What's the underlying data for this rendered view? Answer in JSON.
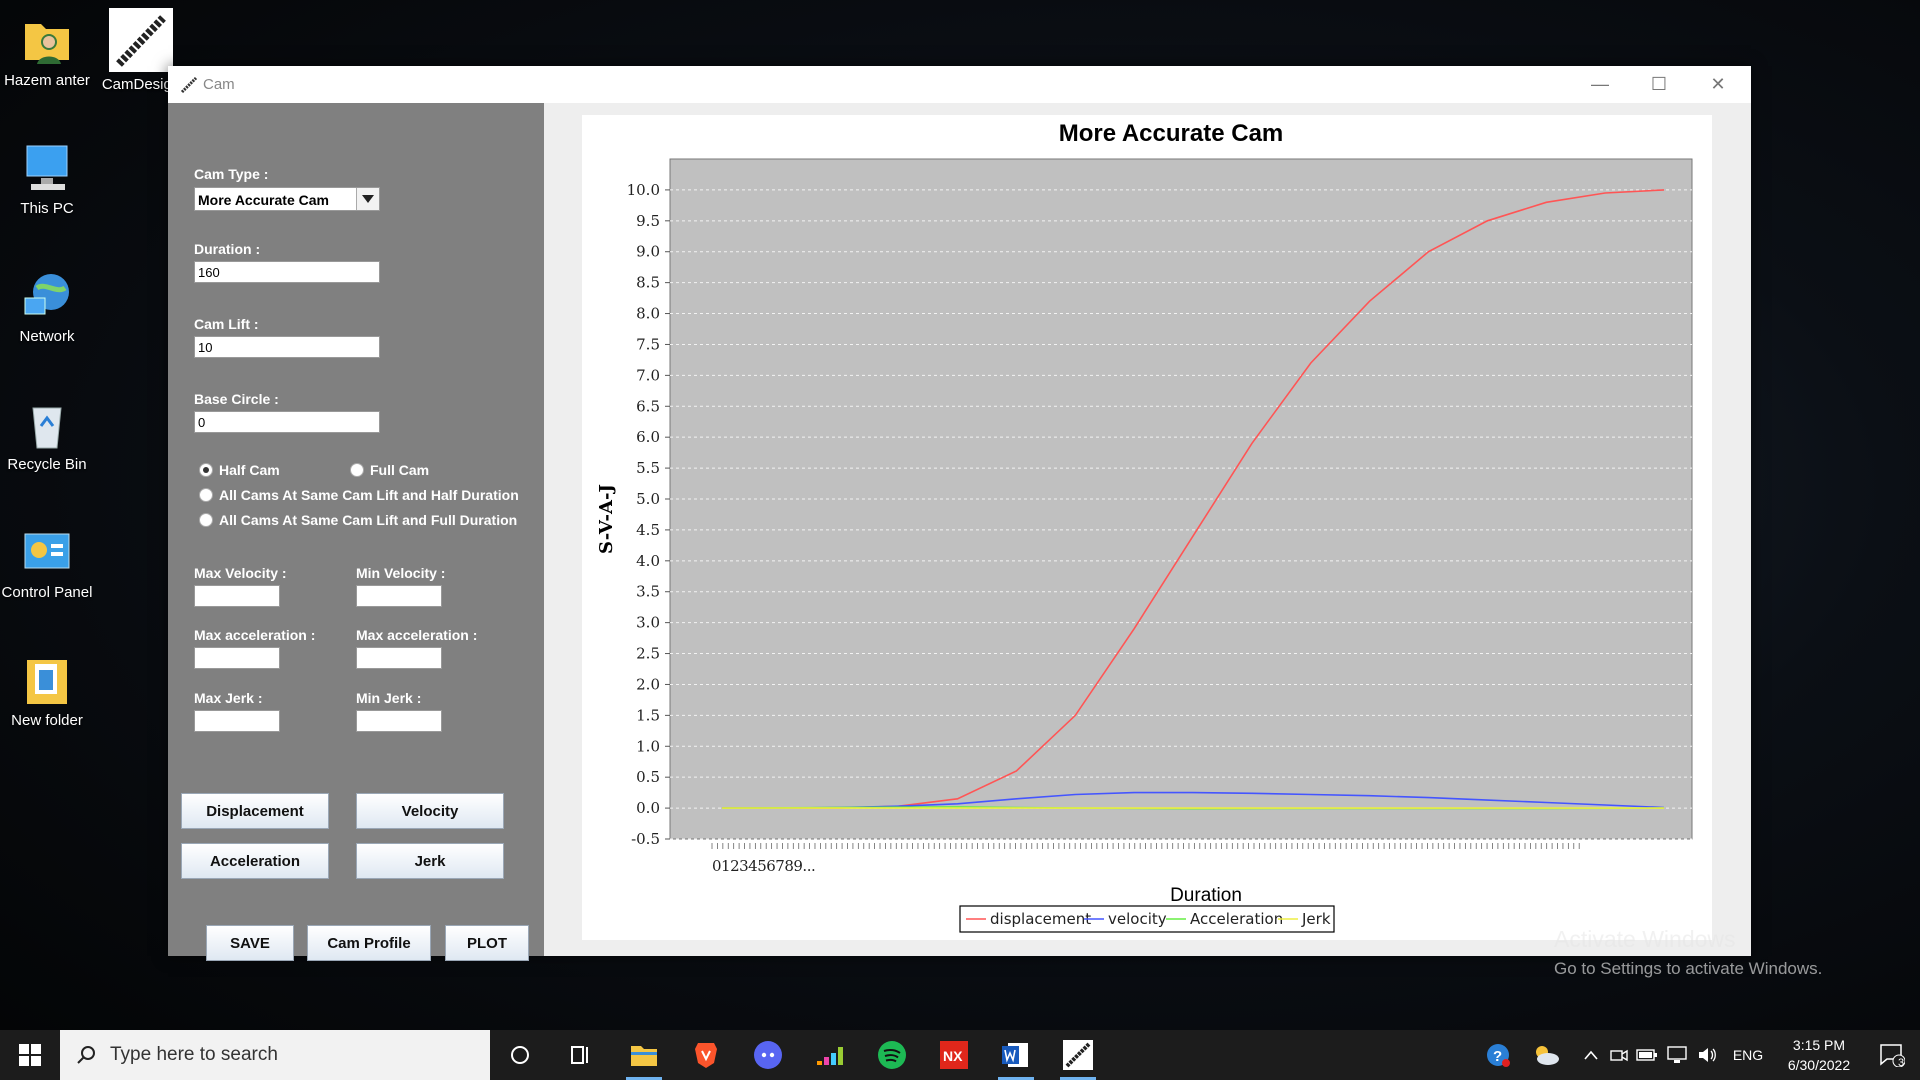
{
  "desktop": {
    "icons": [
      {
        "label": "Hazem anter"
      },
      {
        "label": "CamDesign"
      },
      {
        "label": "This PC"
      },
      {
        "label": "Network"
      },
      {
        "label": "Recycle Bin"
      },
      {
        "label": "Control Panel"
      },
      {
        "label": "New folder"
      }
    ],
    "watermark_title": "Activate Windows",
    "watermark_sub": "Go to Settings to activate Windows."
  },
  "window": {
    "title": "Cam",
    "minimize": "—",
    "maximize": "☐",
    "close": "✕"
  },
  "form": {
    "cam_type_label": "Cam Type :",
    "cam_type_value": "More Accurate Cam",
    "duration_label": "Duration :",
    "duration_value": "160",
    "cam_lift_label": "Cam Lift :",
    "cam_lift_value": "10",
    "base_circle_label": "Base Circle :",
    "base_circle_value": "0",
    "half_cam": "Half Cam",
    "full_cam": "Full Cam",
    "all_half": "All Cams At Same Cam Lift and Half Duration",
    "all_full": "All Cams At Same Cam Lift and Full Duration",
    "max_velocity_label": "Max Velocity :",
    "min_velocity_label": "Min Velocity :",
    "max_accel_label": "Max acceleration :",
    "max_accel_label_2": "Max acceleration :",
    "max_jerk_label": "Max Jerk :",
    "min_jerk_label": "Min Jerk :",
    "max_velocity_value": "",
    "min_velocity_value": "",
    "max_accel_value": "",
    "max_accel_value_2": "",
    "max_jerk_value": "",
    "min_jerk_value": ""
  },
  "buttons": {
    "displacement": "Displacement",
    "velocity": "Velocity",
    "acceleration": "Acceleration",
    "jerk": "Jerk",
    "save": "SAVE",
    "cam_profile": "Cam Profile",
    "plot": "PLOT"
  },
  "chart_data": {
    "type": "line",
    "title": "More Accurate Cam",
    "xlabel": "Duration",
    "ylabel": "S-V-A-J",
    "xlim": [
      0,
      160
    ],
    "ylim": [
      -0.5,
      10.5
    ],
    "y_ticks": [
      "-0.5",
      "0.0",
      "0.5",
      "1.0",
      "1.5",
      "2.0",
      "2.5",
      "3.0",
      "3.5",
      "4.0",
      "4.5",
      "5.0",
      "5.5",
      "6.0",
      "6.5",
      "7.0",
      "7.5",
      "8.0",
      "8.5",
      "9.0",
      "9.5",
      "10.0"
    ],
    "x_tick_labels_visible": "0123456789...",
    "grid": true,
    "legend_position": "bottom",
    "series": [
      {
        "name": "displacement",
        "color": "#ff5555",
        "x": [
          0,
          10,
          20,
          30,
          40,
          50,
          60,
          70,
          80,
          90,
          100,
          110,
          120,
          130,
          140,
          150,
          160
        ],
        "values": [
          0.0,
          0.0,
          0.0,
          0.03,
          0.15,
          0.6,
          1.5,
          2.9,
          4.4,
          5.9,
          7.2,
          8.2,
          9.0,
          9.5,
          9.8,
          9.95,
          10.0
        ]
      },
      {
        "name": "velocity",
        "color": "#4455ff",
        "x": [
          0,
          10,
          20,
          30,
          40,
          50,
          60,
          70,
          80,
          90,
          100,
          110,
          120,
          130,
          140,
          150,
          160
        ],
        "values": [
          0.0,
          0.0,
          0.01,
          0.03,
          0.07,
          0.15,
          0.22,
          0.25,
          0.25,
          0.24,
          0.22,
          0.2,
          0.17,
          0.13,
          0.09,
          0.05,
          0.01
        ]
      },
      {
        "name": "Acceleration",
        "color": "#66ee44",
        "x": [
          0,
          20,
          40,
          60,
          80,
          100,
          120,
          140,
          160
        ],
        "values": [
          0.0,
          0.01,
          0.02,
          0.0,
          -0.01,
          -0.005,
          -0.005,
          -0.005,
          0.0
        ]
      },
      {
        "name": "Jerk",
        "color": "#eeee44",
        "x": [
          0,
          40,
          80,
          120,
          160
        ],
        "values": [
          0.0,
          0.0,
          0.0,
          0.0,
          0.0
        ]
      }
    ]
  },
  "taskbar": {
    "search_placeholder": "Type here to search",
    "language": "ENG",
    "time": "3:15 PM",
    "date": "6/30/2022",
    "notification_count": "3"
  }
}
